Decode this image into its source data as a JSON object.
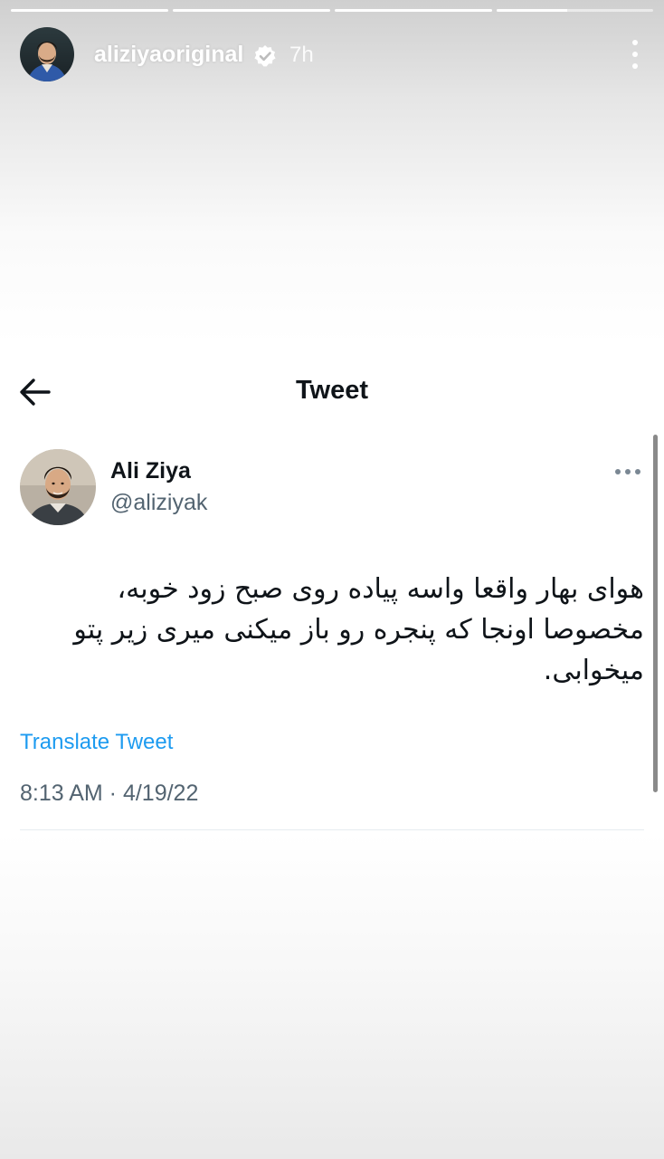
{
  "story": {
    "progress": [
      1,
      1,
      1,
      0.45
    ],
    "username": "aliziyaoriginal",
    "time_ago": "7h",
    "icons": {
      "verified": "verified-badge-icon",
      "more": "more-vertical-icon"
    }
  },
  "tweet": {
    "nav_title": "Tweet",
    "author_name": "Ali Ziya",
    "author_handle": "@aliziyak",
    "text": "هوای بهار واقعا واسه پیاده روی صبح زود خوبه، مخصوصا اونجا که پنجره رو باز میکنی میری زیر پتو میخوابی.",
    "translate_label": "Translate Tweet",
    "timestamp": "8:13 AM · 4/19/22",
    "icons": {
      "back": "arrow-left-icon",
      "more": "more-horizontal-icon"
    }
  },
  "colors": {
    "link": "#1d9bf0",
    "text_primary": "#0f1419",
    "text_secondary": "#536471"
  }
}
